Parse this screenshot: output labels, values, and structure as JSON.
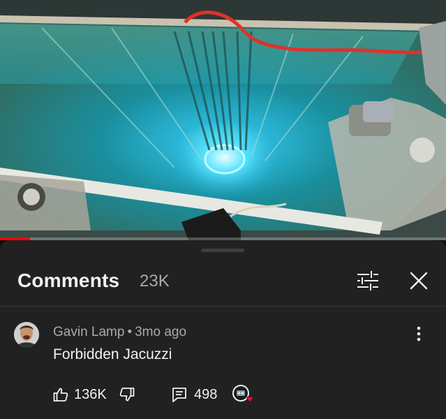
{
  "video": {
    "progress_fraction": 0.068,
    "progress_color": "#ff0000"
  },
  "comments_panel": {
    "title": "Comments",
    "count": "23K"
  },
  "comment": {
    "author": "Gavin Lamp",
    "separator": "•",
    "time_ago": "3mo ago",
    "text": "Forbidden Jacuzzi",
    "likes": "136K",
    "replies": "498"
  },
  "icons": {
    "filter": "sliders-icon",
    "close": "close-icon",
    "more": "more-vertical-icon",
    "like": "thumbs-up-icon",
    "dislike": "thumbs-down-icon",
    "replies": "comment-icon",
    "creator_heart": "creator-heart-icon"
  },
  "colors": {
    "sheet_bg": "#212121",
    "text_primary": "#f1f1f1",
    "text_secondary": "#aaaaaa",
    "heart": "#ff0033"
  }
}
